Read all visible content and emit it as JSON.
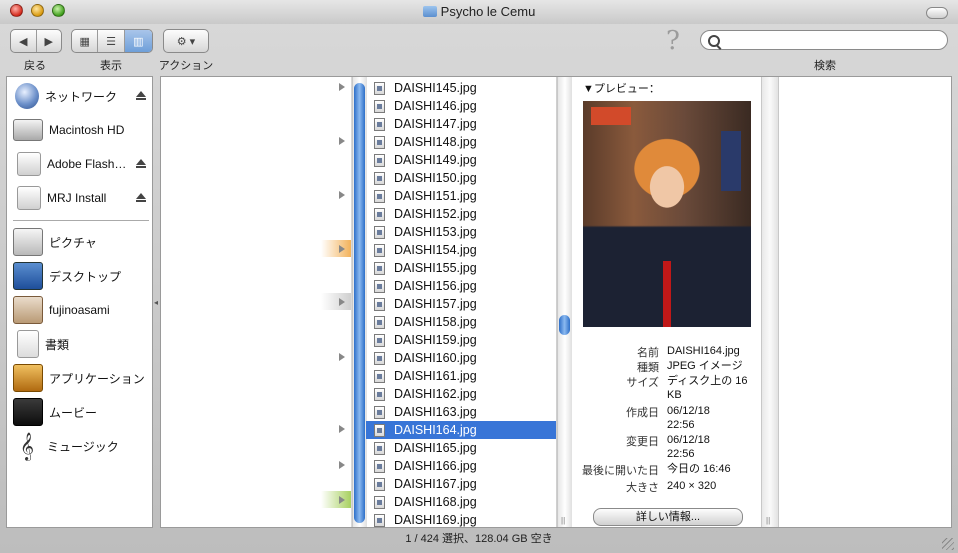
{
  "window": {
    "title": "Psycho le Cemu",
    "status": "1 / 424 選択、128.04 GB 空き"
  },
  "toolbar": {
    "back_label": "戻る",
    "view_label": "表示",
    "action_label": "アクション",
    "search_label": "検索",
    "search_placeholder": "",
    "help_glyph": "?"
  },
  "sidebar": {
    "devices": [
      {
        "label": "ネットワーク",
        "icon": "network-icon",
        "eject": true
      },
      {
        "label": "Macintosh HD",
        "icon": "hard-disk-icon",
        "eject": false
      },
      {
        "label": "Adobe Flash…",
        "icon": "disk-image-icon",
        "eject": true
      },
      {
        "label": "MRJ Install",
        "icon": "disk-image-icon",
        "eject": true
      }
    ],
    "places": [
      {
        "label": "ピクチャ",
        "icon": "pictures-icon"
      },
      {
        "label": "デスクトップ",
        "icon": "desktop-icon"
      },
      {
        "label": "fujinoasami",
        "icon": "home-icon"
      },
      {
        "label": "書類",
        "icon": "documents-icon"
      },
      {
        "label": "アプリケーション",
        "icon": "applications-icon"
      },
      {
        "label": "ムービー",
        "icon": "movies-icon"
      },
      {
        "label": "ミュージック",
        "icon": "music-icon"
      }
    ]
  },
  "files": [
    "DAISHI145.jpg",
    "DAISHI146.jpg",
    "DAISHI147.jpg",
    "DAISHI148.jpg",
    "DAISHI149.jpg",
    "DAISHI150.jpg",
    "DAISHI151.jpg",
    "DAISHI152.jpg",
    "DAISHI153.jpg",
    "DAISHI154.jpg",
    "DAISHI155.jpg",
    "DAISHI156.jpg",
    "DAISHI157.jpg",
    "DAISHI158.jpg",
    "DAISHI159.jpg",
    "DAISHI160.jpg",
    "DAISHI161.jpg",
    "DAISHI162.jpg",
    "DAISHI163.jpg",
    "DAISHI164.jpg",
    "DAISHI165.jpg",
    "DAISHI166.jpg",
    "DAISHI167.jpg",
    "DAISHI168.jpg",
    "DAISHI169.jpg"
  ],
  "selected_file": "DAISHI164.jpg",
  "preview": {
    "header": "▼プレビュー：",
    "info": [
      {
        "key": "名前",
        "value": "DAISHI164.jpg"
      },
      {
        "key": "種類",
        "value": "JPEG イメージ"
      },
      {
        "key": "サイズ",
        "value": "ディスク上の 16 KB"
      },
      {
        "key": "作成日",
        "value": "06/12/18 22:56"
      },
      {
        "key": "変更日",
        "value": "06/12/18 22:56"
      },
      {
        "key": "最後に開いた日",
        "value": "今日の 16:46"
      },
      {
        "key": "大きさ",
        "value": "240 × 320"
      }
    ],
    "more_info_button": "詳しい情報..."
  }
}
